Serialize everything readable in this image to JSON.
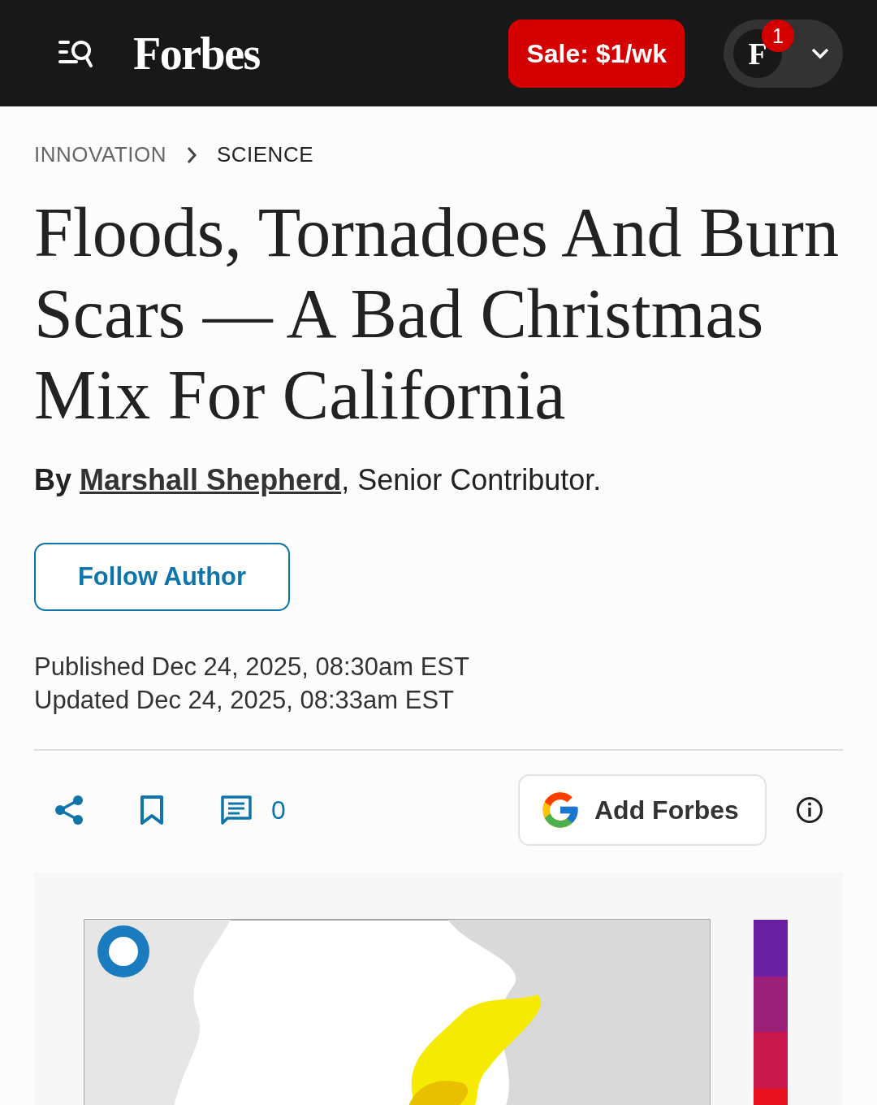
{
  "header": {
    "logo": "Forbes",
    "sale_button": "Sale: $1/wk",
    "account": {
      "initial": "F",
      "notification_count": "1"
    }
  },
  "breadcrumbs": [
    {
      "label": "INNOVATION",
      "current": false
    },
    {
      "label": "SCIENCE",
      "current": true
    }
  ],
  "article": {
    "title": "Floods, Tornadoes And Burn Scars — A Bad Christmas Mix For California",
    "byline": {
      "prefix": "By",
      "author": "Marshall Shepherd",
      "role": ", Senior Contributor."
    },
    "follow_button": "Follow Author",
    "published": "Published Dec 24, 2025, 08:30am EST",
    "updated": "Updated Dec 24, 2025, 08:33am EST",
    "comment_count": "0",
    "add_button": "Add Forbes"
  }
}
